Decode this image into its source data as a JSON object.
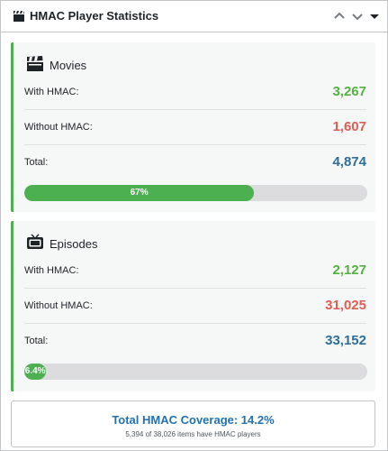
{
  "header": {
    "title": "HMAC Player Statistics",
    "icon": "clapperboard-icon",
    "controls": [
      "chevron-up-icon",
      "chevron-down-icon",
      "caret-down-icon"
    ]
  },
  "colors": {
    "with": "#53b33f",
    "without": "#e25c54",
    "total": "#2d6e9a",
    "bar": "#4caf50",
    "accent": "#2271b1"
  },
  "movies": {
    "title": "Movies",
    "icon": "clapperboard-icon",
    "with_label": "With HMAC:",
    "with_value": "3,267",
    "without_label": "Without HMAC:",
    "without_value": "1,607",
    "total_label": "Total:",
    "total_value": "4,874",
    "progress_percent": 67,
    "progress_label": "67%"
  },
  "episodes": {
    "title": "Episodes",
    "icon": "tv-icon",
    "with_label": "With HMAC:",
    "with_value": "2,127",
    "without_label": "Without HMAC:",
    "without_value": "31,025",
    "total_label": "Total:",
    "total_value": "33,152",
    "progress_percent": 6.4,
    "progress_label": "6.4%"
  },
  "summary": {
    "title": "Total HMAC Coverage: 14.2%",
    "subtitle": "5,394 of 38,026 items have HMAC players"
  }
}
